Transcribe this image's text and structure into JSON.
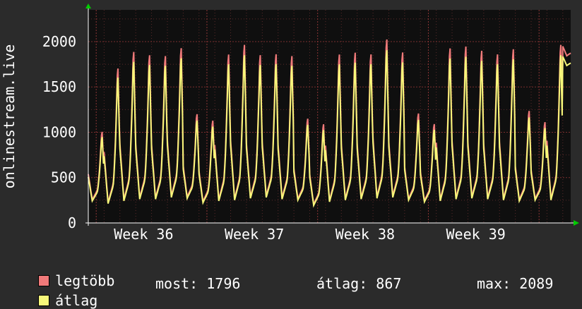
{
  "chart_data": {
    "type": "line",
    "ylabel": "onlinestream.live",
    "ylim": [
      0,
      2350
    ],
    "yticks": [
      0,
      500,
      1000,
      1500,
      2000
    ],
    "xlim": [
      0,
      30.5
    ],
    "xticks": [
      {
        "label": "Week 36",
        "x": 3.5
      },
      {
        "label": "Week 37",
        "x": 10.5
      },
      {
        "label": "Week 38",
        "x": 17.5
      },
      {
        "label": "Week 39",
        "x": 24.5
      }
    ],
    "grid": true,
    "colors": {
      "plot_bg": "#0f0f0f",
      "legtobb": "#f07a7a",
      "atlag": "#f7f77a",
      "grid": "#5a2a2a",
      "axis": "#ffffff",
      "arrow": "#00cc00"
    },
    "days": [
      {
        "min": 250,
        "max": 1030
      },
      {
        "min": 220,
        "max": 1760
      },
      {
        "min": 250,
        "max": 1950
      },
      {
        "min": 270,
        "max": 1910
      },
      {
        "min": 270,
        "max": 1900
      },
      {
        "min": 290,
        "max": 1990
      },
      {
        "min": 280,
        "max": 1230
      },
      {
        "min": 230,
        "max": 1160
      },
      {
        "min": 250,
        "max": 1920
      },
      {
        "min": 260,
        "max": 2030
      },
      {
        "min": 280,
        "max": 1910
      },
      {
        "min": 290,
        "max": 1920
      },
      {
        "min": 270,
        "max": 1900
      },
      {
        "min": 260,
        "max": 1180
      },
      {
        "min": 200,
        "max": 1120
      },
      {
        "min": 240,
        "max": 1920
      },
      {
        "min": 260,
        "max": 1940
      },
      {
        "min": 270,
        "max": 1920
      },
      {
        "min": 280,
        "max": 2090
      },
      {
        "min": 290,
        "max": 1940
      },
      {
        "min": 260,
        "max": 1240
      },
      {
        "min": 240,
        "max": 1120
      },
      {
        "min": 250,
        "max": 1990
      },
      {
        "min": 270,
        "max": 2010
      },
      {
        "min": 280,
        "max": 1960
      },
      {
        "min": 270,
        "max": 1920
      },
      {
        "min": 260,
        "max": 1980
      },
      {
        "min": 250,
        "max": 1270
      },
      {
        "min": 260,
        "max": 1140
      },
      {
        "min": 260,
        "max": 2030
      },
      {
        "min": 1790,
        "max": 2080
      }
    ],
    "series": [
      {
        "name": "legtöbb",
        "color": "#f07a7a"
      },
      {
        "name": "átlag",
        "color": "#f7f77a"
      }
    ]
  },
  "legend": {
    "max_label": "legtöbb",
    "avg_label": "átlag"
  },
  "stats": {
    "now": "most: 1796",
    "avg": "átlag: 867",
    "max": "max: 2089"
  }
}
